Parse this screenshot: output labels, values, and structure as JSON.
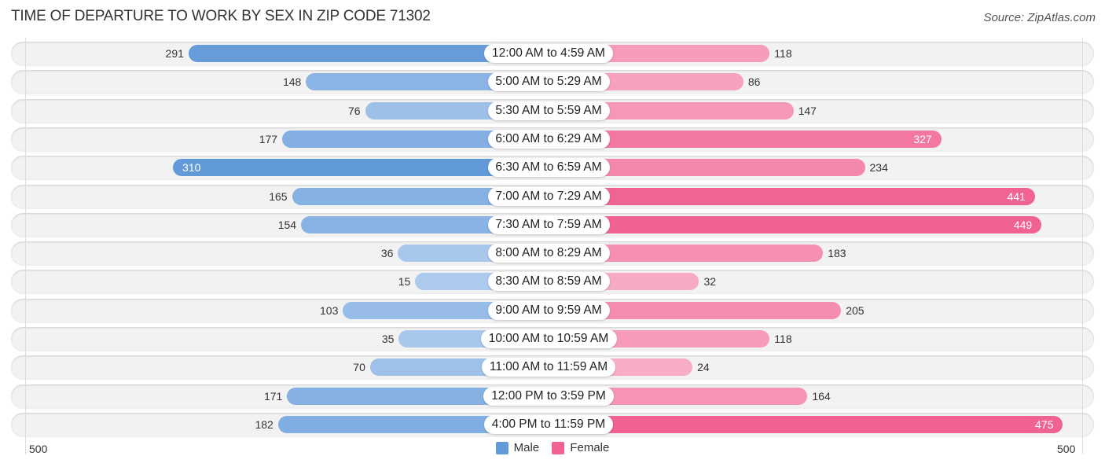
{
  "title": "TIME OF DEPARTURE TO WORK BY SEX IN ZIP CODE 71302",
  "source": "Source: ZipAtlas.com",
  "colors": {
    "male_strong": "#6199d9",
    "male_light": "#b0cdee",
    "female_strong": "#f06292",
    "female_light": "#f8b0c8",
    "row_bg": "#f2f2f2"
  },
  "chart_data": {
    "type": "bar",
    "orientation": "horizontal-diverging",
    "title": "TIME OF DEPARTURE TO WORK BY SEX IN ZIP CODE 71302",
    "categories": [
      "12:00 AM to 4:59 AM",
      "5:00 AM to 5:29 AM",
      "5:30 AM to 5:59 AM",
      "6:00 AM to 6:29 AM",
      "6:30 AM to 6:59 AM",
      "7:00 AM to 7:29 AM",
      "7:30 AM to 7:59 AM",
      "8:00 AM to 8:29 AM",
      "8:30 AM to 8:59 AM",
      "9:00 AM to 9:59 AM",
      "10:00 AM to 10:59 AM",
      "11:00 AM to 11:59 AM",
      "12:00 PM to 3:59 PM",
      "4:00 PM to 11:59 PM"
    ],
    "series": [
      {
        "name": "Male",
        "values": [
          291,
          148,
          76,
          177,
          310,
          165,
          154,
          36,
          15,
          103,
          35,
          70,
          171,
          182
        ]
      },
      {
        "name": "Female",
        "values": [
          118,
          86,
          147,
          327,
          234,
          441,
          449,
          183,
          32,
          205,
          118,
          24,
          164,
          475
        ]
      }
    ],
    "axis": {
      "left_label": "500",
      "right_label": "500",
      "range": [
        0,
        500
      ]
    },
    "legend": {
      "entries": [
        "Male",
        "Female"
      ],
      "placement": "bottom-center"
    },
    "xlabel": "",
    "ylabel": "",
    "grid": false
  }
}
